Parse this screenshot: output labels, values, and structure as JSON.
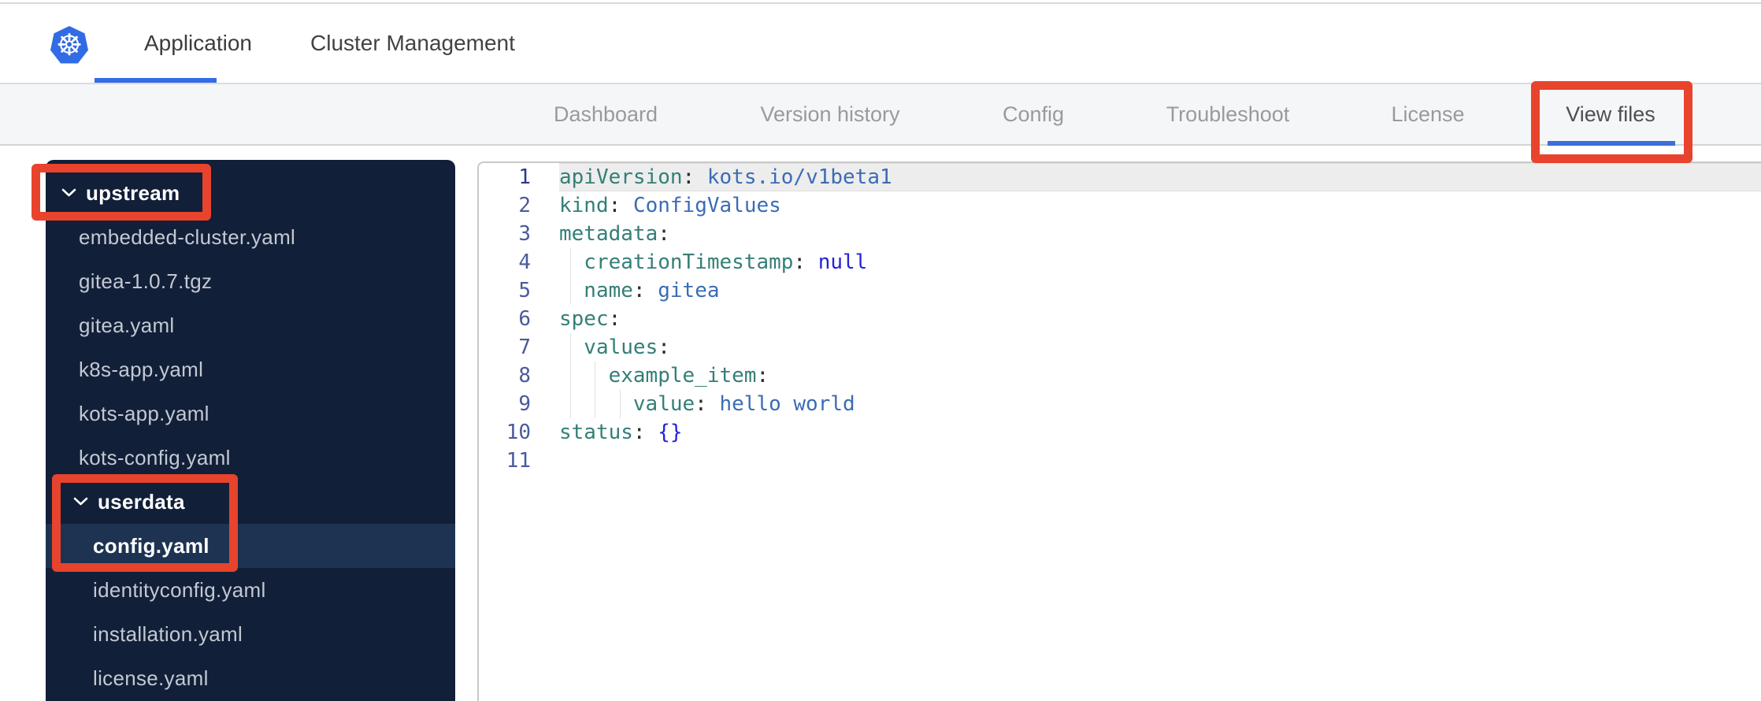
{
  "topbar": {
    "tabs": [
      {
        "label": "Application",
        "active": true
      },
      {
        "label": "Cluster Management",
        "active": false
      }
    ]
  },
  "subnav": {
    "tabs": [
      {
        "label": "Dashboard",
        "active": false
      },
      {
        "label": "Version history",
        "active": false
      },
      {
        "label": "Config",
        "active": false
      },
      {
        "label": "Troubleshoot",
        "active": false
      },
      {
        "label": "License",
        "active": false
      },
      {
        "label": "View files",
        "active": true
      }
    ]
  },
  "sidebar": {
    "items": [
      {
        "kind": "folder",
        "label": "upstream",
        "indent": 0,
        "expanded": true,
        "selected": false
      },
      {
        "kind": "file",
        "label": "embedded-cluster.yaml",
        "indent": 1,
        "selected": false
      },
      {
        "kind": "file",
        "label": "gitea-1.0.7.tgz",
        "indent": 1,
        "selected": false
      },
      {
        "kind": "file",
        "label": "gitea.yaml",
        "indent": 1,
        "selected": false
      },
      {
        "kind": "file",
        "label": "k8s-app.yaml",
        "indent": 1,
        "selected": false
      },
      {
        "kind": "file",
        "label": "kots-app.yaml",
        "indent": 1,
        "selected": false
      },
      {
        "kind": "file",
        "label": "kots-config.yaml",
        "indent": 1,
        "selected": false
      },
      {
        "kind": "folder",
        "label": "userdata",
        "indent": 1,
        "expanded": true,
        "selected": false
      },
      {
        "kind": "file",
        "label": "config.yaml",
        "indent": 2,
        "selected": true
      },
      {
        "kind": "file",
        "label": "identityconfig.yaml",
        "indent": 2,
        "selected": false
      },
      {
        "kind": "file",
        "label": "installation.yaml",
        "indent": 2,
        "selected": false
      },
      {
        "kind": "file",
        "label": "license.yaml",
        "indent": 2,
        "selected": false
      }
    ]
  },
  "editor": {
    "lines": [
      {
        "num": "1",
        "active": true,
        "indent": 0,
        "tokens": [
          [
            "key",
            "apiVersion"
          ],
          [
            "p",
            ": "
          ],
          [
            "val",
            "kots.io/v1beta1"
          ]
        ]
      },
      {
        "num": "2",
        "active": false,
        "indent": 0,
        "tokens": [
          [
            "key",
            "kind"
          ],
          [
            "p",
            ": "
          ],
          [
            "val",
            "ConfigValues"
          ]
        ]
      },
      {
        "num": "3",
        "active": false,
        "indent": 0,
        "tokens": [
          [
            "key",
            "metadata"
          ],
          [
            "p",
            ":"
          ]
        ]
      },
      {
        "num": "4",
        "active": false,
        "indent": 1,
        "tokens": [
          [
            "key",
            "creationTimestamp"
          ],
          [
            "p",
            ": "
          ],
          [
            "const",
            "null"
          ]
        ]
      },
      {
        "num": "5",
        "active": false,
        "indent": 1,
        "tokens": [
          [
            "key",
            "name"
          ],
          [
            "p",
            ": "
          ],
          [
            "val",
            "gitea"
          ]
        ]
      },
      {
        "num": "6",
        "active": false,
        "indent": 0,
        "tokens": [
          [
            "key",
            "spec"
          ],
          [
            "p",
            ":"
          ]
        ]
      },
      {
        "num": "7",
        "active": false,
        "indent": 1,
        "tokens": [
          [
            "key",
            "values"
          ],
          [
            "p",
            ":"
          ]
        ]
      },
      {
        "num": "8",
        "active": false,
        "indent": 2,
        "tokens": [
          [
            "key",
            "example_item"
          ],
          [
            "p",
            ":"
          ]
        ]
      },
      {
        "num": "9",
        "active": false,
        "indent": 3,
        "tokens": [
          [
            "key",
            "value"
          ],
          [
            "p",
            ": "
          ],
          [
            "val",
            "hello world"
          ]
        ]
      },
      {
        "num": "10",
        "active": false,
        "indent": 0,
        "tokens": [
          [
            "key",
            "status"
          ],
          [
            "p",
            ": "
          ],
          [
            "const",
            "{}"
          ]
        ]
      },
      {
        "num": "11",
        "active": false,
        "indent": 0,
        "tokens": []
      }
    ]
  },
  "annotations": {
    "color": "#e8432c",
    "boxes": [
      {
        "target": "view-files-tab"
      },
      {
        "target": "upstream-folder"
      },
      {
        "target": "userdata-config-file"
      }
    ]
  },
  "colors": {
    "kubernetes_blue": "#326ce5",
    "active_tab_underline": "#326de6",
    "sidebar_bg": "#121f38",
    "sidebar_selected_bg": "#1d3351",
    "subnav_bg": "#f5f6f7",
    "code_key": "#347f77",
    "code_value": "#3a6cb5",
    "code_constant": "#2522d8",
    "annotation_red": "#e8432c"
  }
}
